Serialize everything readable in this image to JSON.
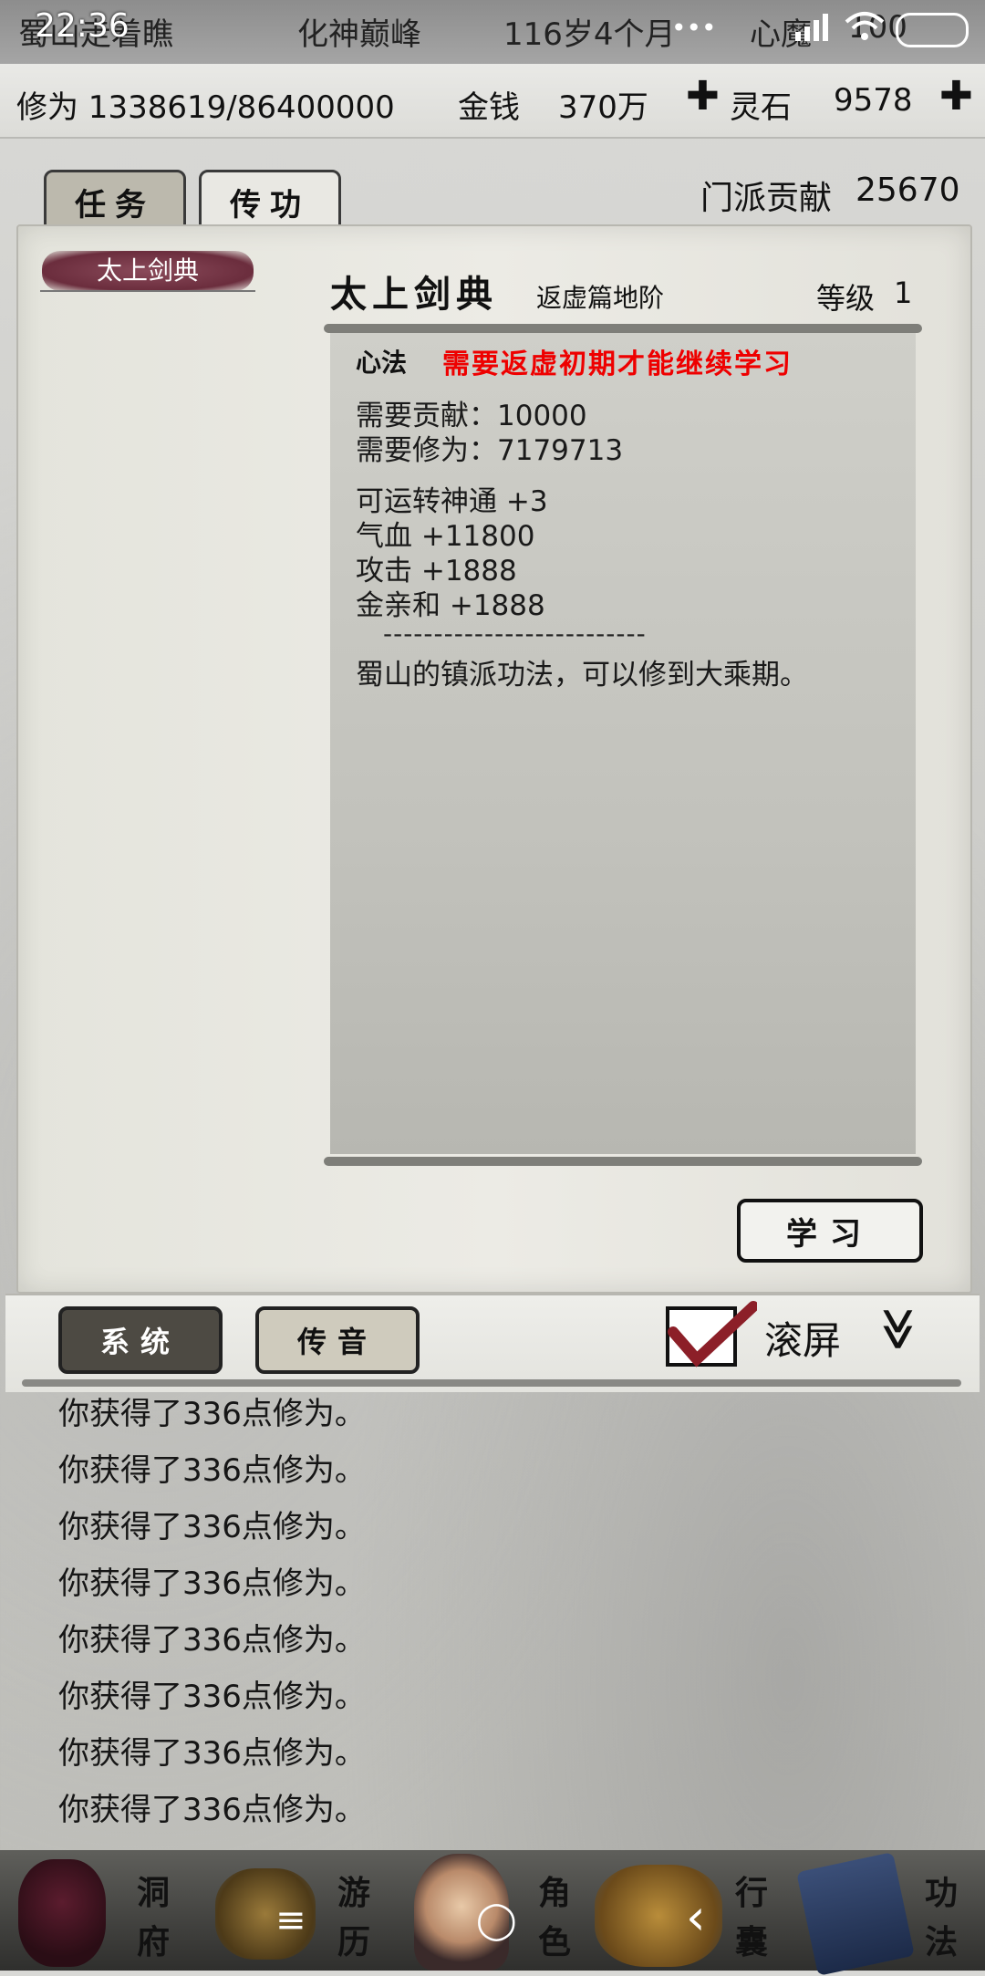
{
  "status_bar": {
    "time": "22:36",
    "overlay_left": "蜀山走着瞧",
    "overlay_realm": "化神巅峰",
    "overlay_age": "116岁4个月",
    "overlay_xinmo": "心魔",
    "overlay_value": "100",
    "battery": "100",
    "dots": "•••"
  },
  "resources": {
    "xiuwei": "修为 1338619/86400000",
    "money_label": "金钱",
    "money_value": "370万",
    "lingshi_label": "灵石",
    "lingshi_value": "9578",
    "plus": "✚"
  },
  "tabs": {
    "task": "任务",
    "chuangong": "传功"
  },
  "contribution": {
    "label": "门派贡献",
    "value": "25670"
  },
  "sidebar": {
    "selected": "太上剑典"
  },
  "detail": {
    "title": "太上剑典",
    "subtitle": "返虚篇地阶",
    "level_label": "等级",
    "level_value": "1",
    "xinfa_label": "心法",
    "xinfa_requirement": "需要返虚初期才能继续学习",
    "need_contrib": "需要贡献：10000",
    "need_xiuwei": "需要修为：7179713",
    "stat1": "可运转神通 +3",
    "stat2": "气血 +11800",
    "stat3": "攻击 +1888",
    "stat4": "金亲和 +1888",
    "divider": "--------------------------",
    "description": "蜀山的镇派功法，可以修到大乘期。",
    "learn_button": "学习"
  },
  "chat": {
    "tab_system": "系统",
    "tab_chuanyin": "传音",
    "scroll_label": "滚屏",
    "chevron": "≫",
    "messages": [
      "你获得了336点修为。",
      "你获得了336点修为。",
      "你获得了336点修为。",
      "你获得了336点修为。",
      "你获得了336点修为。",
      "你获得了336点修为。",
      "你获得了336点修为。",
      "你获得了336点修为。"
    ]
  },
  "bottom_nav": {
    "dongfu_1": "洞",
    "dongfu_2": "府",
    "youli_1": "游",
    "youli_2": "历",
    "juese_1": "角",
    "juese_2": "色",
    "xingnang_1": "行",
    "xingnang_2": "囊",
    "gongfa_1": "功",
    "gongfa_2": "法",
    "menu_glyph": "≡",
    "home_glyph": "◯",
    "back_glyph": "‹"
  }
}
